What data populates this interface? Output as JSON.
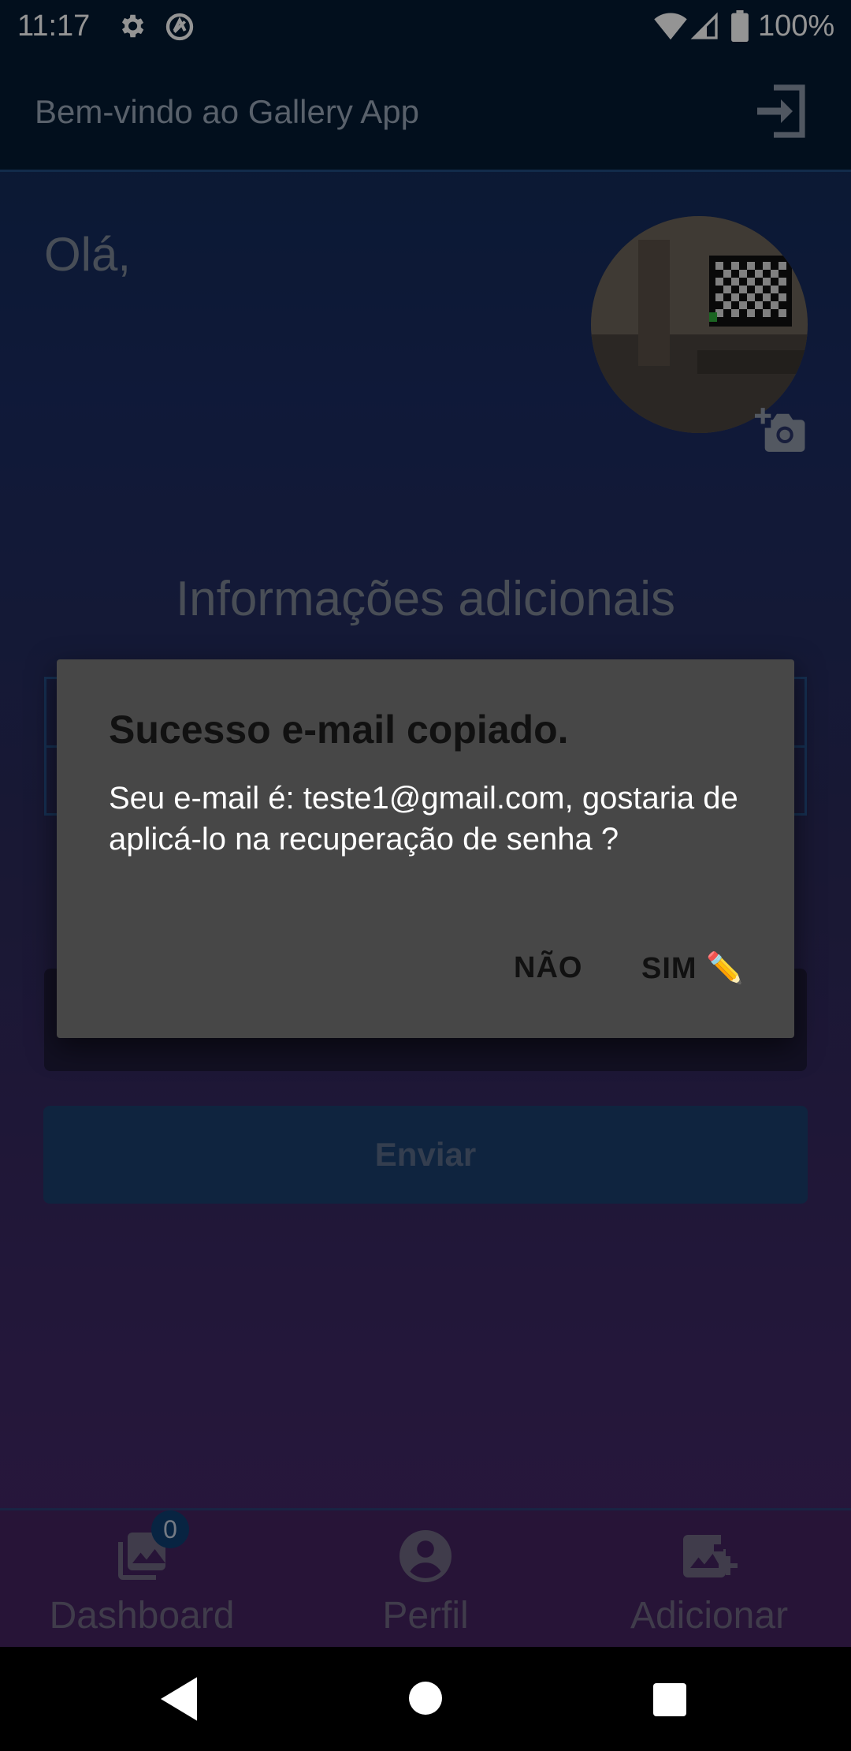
{
  "status_bar": {
    "time": "11:17",
    "battery": "100%",
    "icons": [
      "gear-icon",
      "sync-icon",
      "wifi-icon",
      "signal-icon",
      "battery-icon"
    ]
  },
  "toolbar": {
    "title": "Bem-vindo ao Gallery App",
    "logout_icon": "logout-icon"
  },
  "profile": {
    "greeting": "Olá,",
    "section_title": "Informações adicionais",
    "send_label": "Enviar"
  },
  "bottom_nav": {
    "items": [
      {
        "label": "Dashboard",
        "icon": "photo-library-icon",
        "badge": "0"
      },
      {
        "label": "Perfil",
        "icon": "account-circle-icon"
      },
      {
        "label": "Adicionar",
        "icon": "add-photo-icon"
      }
    ]
  },
  "dialog": {
    "title": "Sucesso e-mail copiado.",
    "message": "Seu e-mail é: teste1@gmail.com, gostaria de aplicá-lo na recuperação de senha ?",
    "negative": "NÃO",
    "positive": "SIM ✏️"
  },
  "colors": {
    "toolbar_bg": "#041b33",
    "dialog_bg": "#474747",
    "button_bg": "#1b3f6d",
    "accent_border": "#26538e"
  }
}
